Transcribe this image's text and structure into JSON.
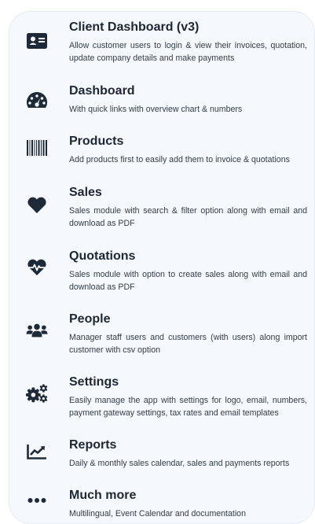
{
  "features": [
    {
      "icon": "id-card-icon",
      "title": "Client Dashboard (v3)",
      "description": "Allow customer users to login & view their invoices, quotation, update company details and make payments"
    },
    {
      "icon": "speedometer-icon",
      "title": "Dashboard",
      "description": "With quick links with overview chart & numbers"
    },
    {
      "icon": "barcode-icon",
      "title": "Products",
      "description": "Add products first to easily add them to invoice & quotations"
    },
    {
      "icon": "heart-icon",
      "title": "Sales",
      "description": "Sales module with search & filter option along with email and download as PDF"
    },
    {
      "icon": "heartbeat-icon",
      "title": "Quotations",
      "description": "Sales module with option to create sales along with email and download as PDF"
    },
    {
      "icon": "users-icon",
      "title": "People",
      "description": "Manager staff users and customers (with users) along import customer with csv option"
    },
    {
      "icon": "cogs-icon",
      "title": "Settings",
      "description": "Easily manage the app with settings for logo, email, numbers, payment gateway settings, tax rates and email templates"
    },
    {
      "icon": "line-chart-icon",
      "title": "Reports",
      "description": "Daily & monthly sales calendar, sales and payments reports"
    },
    {
      "icon": "ellipsis-icon",
      "title": "Much more",
      "description": "Multilingual, Event Calendar and documentation"
    }
  ]
}
